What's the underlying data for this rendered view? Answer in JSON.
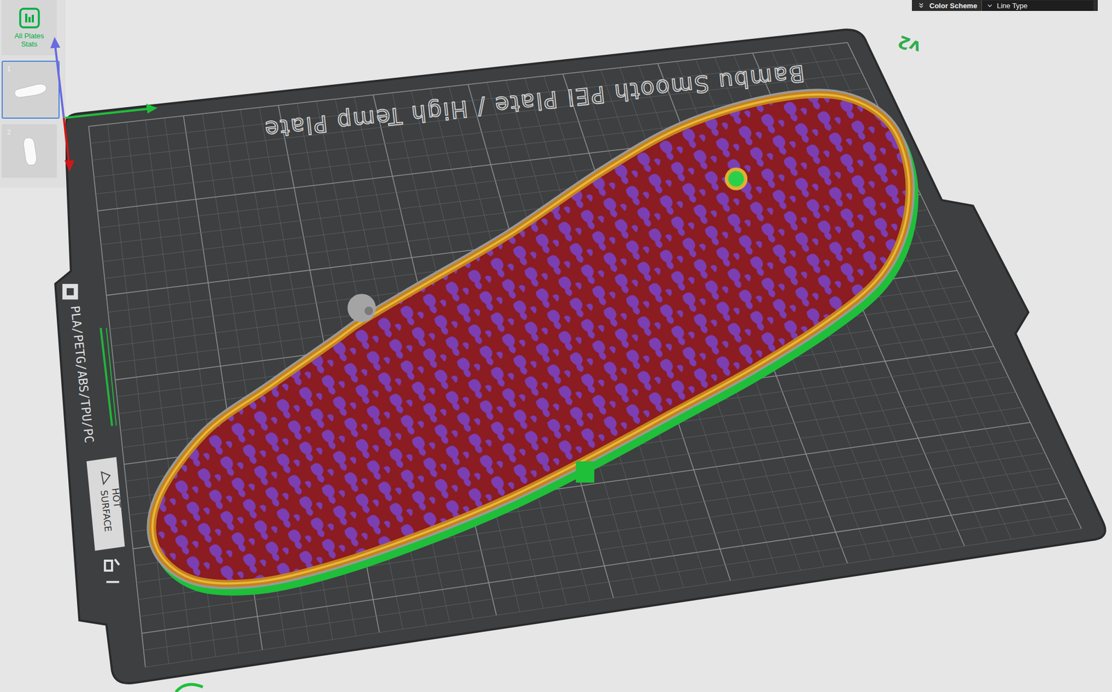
{
  "sidebar": {
    "stats_button": "All Plates Stats",
    "plates": [
      {
        "label": "1",
        "selected": true
      },
      {
        "label": "2",
        "selected": false
      }
    ]
  },
  "color_scheme": {
    "label": "Color Scheme",
    "value": "Line Type"
  },
  "plate": {
    "name": "Bambu Smooth PEI Plate / High Temp Plate",
    "materials": "PLA/PETG/ABS/TPU/PC",
    "warning": [
      "HOT",
      "SURFACE"
    ],
    "version": "v2"
  }
}
